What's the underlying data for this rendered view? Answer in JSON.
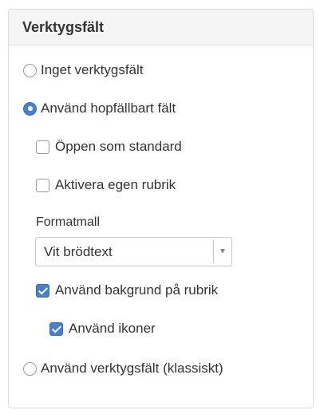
{
  "panel": {
    "title": "Verktygsfält"
  },
  "options": {
    "none_label": "Inget verktygsfält",
    "collapsible_label": "Använd hopfällbart fält",
    "open_default_label": "Öppen som standard",
    "custom_heading_label": "Aktivera egen rubrik",
    "style_label": "Formatmall",
    "style_selected": "Vit brödtext",
    "background_heading_label": "Använd bakgrund på rubrik",
    "icons_label": "Använd ikoner",
    "classic_label": "Använd verktygsfält (klassiskt)"
  },
  "state": {
    "none_selected": false,
    "collapsible_selected": true,
    "open_default_checked": false,
    "custom_heading_checked": false,
    "background_heading_checked": true,
    "icons_checked": true,
    "classic_selected": false
  },
  "colors": {
    "accent": "#4a80c8",
    "header_bg": "#f5f5f5",
    "border": "#dcdcdc",
    "text": "#333333"
  }
}
